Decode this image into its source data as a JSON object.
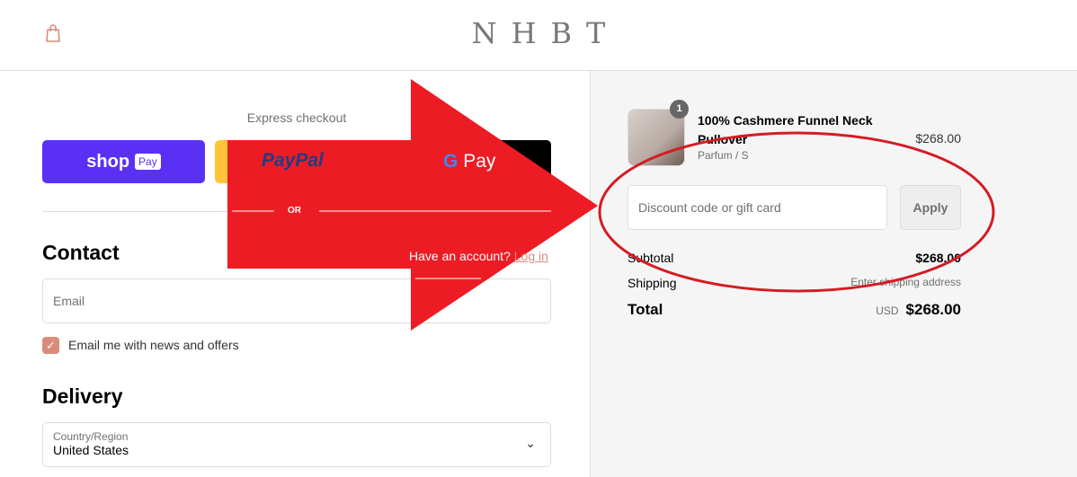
{
  "header": {
    "logo": "NHBT",
    "cart_icon": "shopping-bag-icon"
  },
  "express": {
    "title": "Express checkout",
    "shop_pay": "shop",
    "shop_pay_badge": "Pay",
    "paypal": "PayPal",
    "gpay": "Pay",
    "divider": "OR"
  },
  "contact": {
    "title": "Contact",
    "have_account": "Have an account?",
    "login": "Log in",
    "email_placeholder": "Email",
    "newsletter_label": "Email me with news and offers",
    "newsletter_checked": true
  },
  "delivery": {
    "title": "Delivery",
    "country_label": "Country/Region",
    "country_value": "United States"
  },
  "summary": {
    "item": {
      "qty": "1",
      "name": "100% Cashmere Funnel Neck Pullover",
      "variant": "Parfum / S",
      "price": "$268.00"
    },
    "discount_placeholder": "Discount code or gift card",
    "apply": "Apply",
    "subtotal_label": "Subtotal",
    "subtotal": "$268.00",
    "shipping_label": "Shipping",
    "shipping": "Enter shipping address",
    "total_label": "Total",
    "currency": "USD",
    "total": "$268.00"
  },
  "annotation_color": "#ed1c24"
}
